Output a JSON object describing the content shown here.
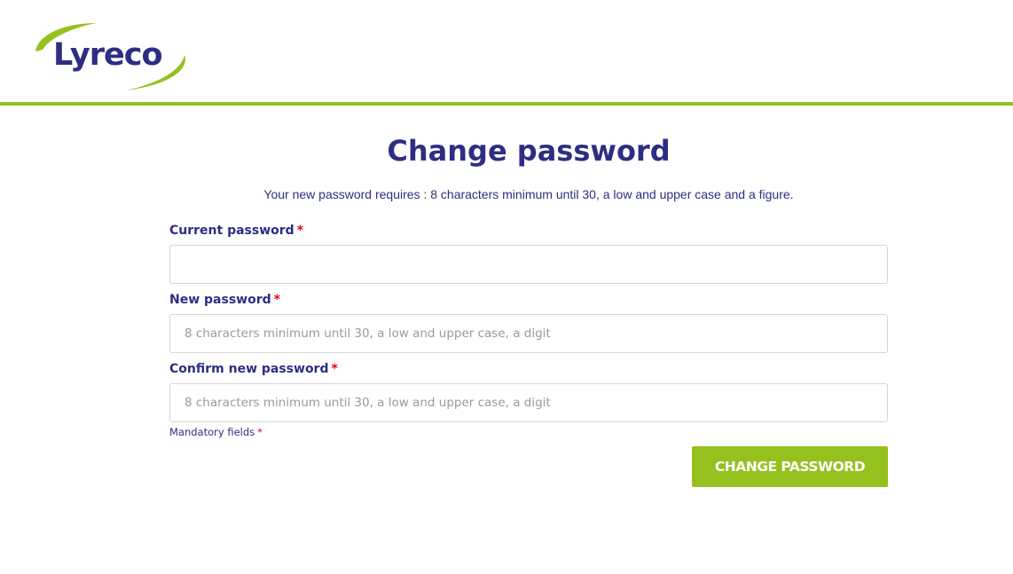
{
  "header": {
    "logo_text": "Lyreco"
  },
  "main": {
    "title": "Change password",
    "requirements": "Your new password requires : 8 characters minimum until 30, a low and upper case and a figure.",
    "fields": [
      {
        "label": "Current password",
        "required_mark": "*",
        "value": "",
        "placeholder": ""
      },
      {
        "label": "New password",
        "required_mark": "*",
        "value": "",
        "placeholder": "8 characters minimum until 30, a low and upper case, a digit"
      },
      {
        "label": "Confirm new password",
        "required_mark": "*",
        "value": "",
        "placeholder": "8 characters minimum until 30, a low and upper case, a digit"
      }
    ],
    "mandatory_note": "Mandatory fields",
    "mandatory_mark": "*",
    "submit_label": "CHANGE PASSWORD"
  },
  "colors": {
    "brand_navy": "#2d2e83",
    "brand_green": "#95c11f",
    "required_red": "#e2001a"
  }
}
